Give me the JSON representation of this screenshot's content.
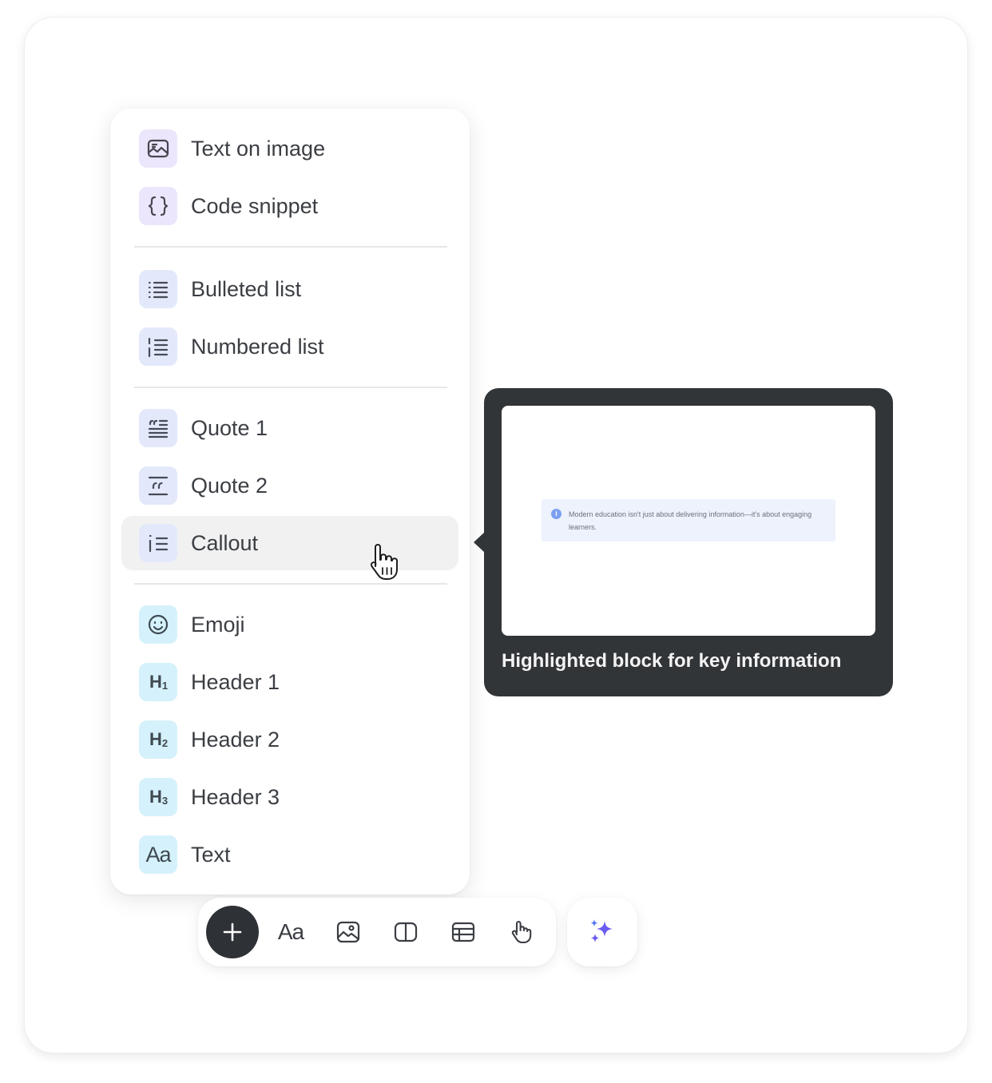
{
  "menu": {
    "items": [
      {
        "label": "Text on image",
        "icon": "image-text-icon"
      },
      {
        "label": "Code snippet",
        "icon": "braces-icon"
      },
      {
        "label": "Bulleted list",
        "icon": "bulleted-list-icon"
      },
      {
        "label": "Numbered list",
        "icon": "numbered-list-icon"
      },
      {
        "label": "Quote 1",
        "icon": "quote-1-icon"
      },
      {
        "label": "Quote 2",
        "icon": "quote-2-icon"
      },
      {
        "label": "Callout",
        "icon": "callout-icon",
        "hovered": true
      },
      {
        "label": "Emoji",
        "icon": "smiley-icon"
      },
      {
        "label": "Header 1",
        "icon": "h1-icon",
        "glyph": "H",
        "sub": "1"
      },
      {
        "label": "Header 2",
        "icon": "h2-icon",
        "glyph": "H",
        "sub": "2"
      },
      {
        "label": "Header 3",
        "icon": "h3-icon",
        "glyph": "H",
        "sub": "3"
      },
      {
        "label": "Text",
        "icon": "text-aa-icon",
        "glyph": "Aa"
      }
    ]
  },
  "tooltip": {
    "preview_text": "Modern education isn't just about delivering information—it's about engaging learners.",
    "caption": "Highlighted block for key information"
  },
  "toolbar": {
    "buttons": [
      "add-icon",
      "text-aa-icon",
      "image-icon",
      "columns-icon",
      "table-icon",
      "interactive-hand-icon"
    ],
    "aa_label": "Aa",
    "ai_icon": "sparkles-icon"
  },
  "colors": {
    "purple_chip": "#ebe6fb",
    "blue_chip": "#e3e9fb",
    "cyan_chip": "#d5f1fb",
    "tooltip_bg": "#323538",
    "ai_accent": "#6b5cf0"
  }
}
